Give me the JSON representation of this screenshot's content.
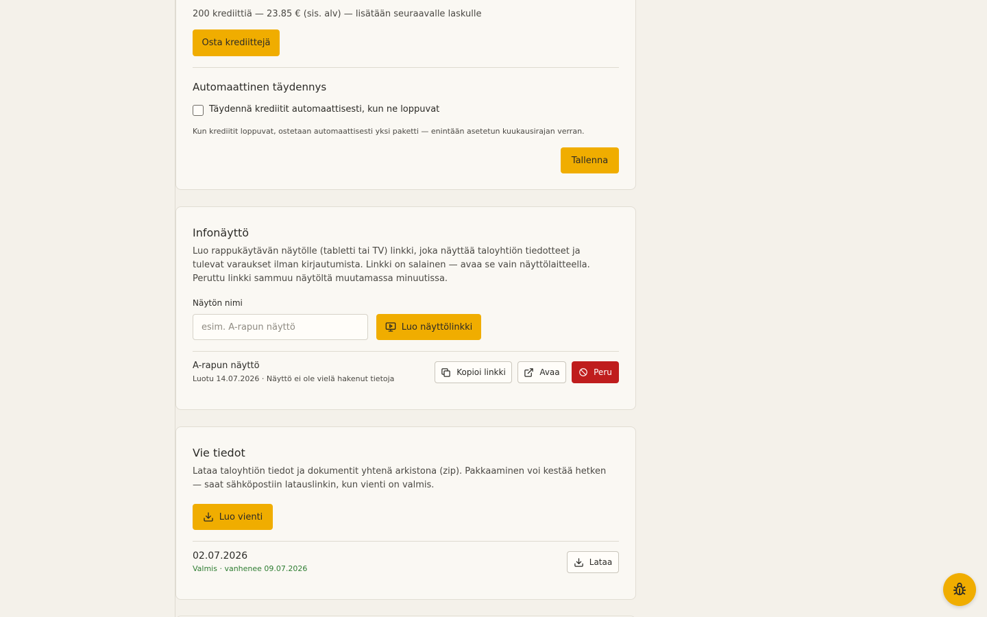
{
  "credits": {
    "package_info": "200 krediittiä — 23.85 € (sis. alv) — lisätään seuraavalle laskulle",
    "buy_label": "Osta krediittejä",
    "auto_title": "Automaattinen täydennys",
    "auto_checkbox_label": "Täydennä krediitit automaattisesti, kun ne loppuvat",
    "auto_checked": false,
    "auto_note": "Kun krediitit loppuvat, ostetaan automaattisesti yksi paketti — enintään asetetun kuukausirajan verran.",
    "save_label": "Tallenna"
  },
  "info_screen": {
    "title": "Infonäyttö",
    "description": "Luo rappukäytävän näytölle (tabletti tai TV) linkki, joka näyttää taloyhtiön tiedotteet ja tulevat varaukset ilman kirjautumista. Linkki on salainen — avaa se vain näyttölaitteella. Peruttu linkki sammuu näytöltä muutamassa minuutissa.",
    "name_label": "Näytön nimi",
    "name_placeholder": "esim. A-rapun näyttö",
    "name_value": "",
    "create_label": "Luo näyttölinkki",
    "screens": [
      {
        "name": "A-rapun näyttö",
        "meta": "Luotu 14.07.2026 · Näyttö ei ole vielä hakenut tietoja",
        "copy_label": "Kopioi linkki",
        "open_label": "Avaa",
        "revoke_label": "Peru"
      }
    ]
  },
  "export": {
    "title": "Vie tiedot",
    "description": "Lataa taloyhtiön tiedot ja dokumentit yhtenä arkistona (zip). Pakkaaminen voi kestää hetken — saat sähköpostiin latauslinkin, kun vienti on valmis.",
    "create_label": "Luo vienti",
    "items": [
      {
        "date": "02.07.2026",
        "status": "Valmis · vanhenee 09.07.2026",
        "download_label": "Lataa"
      }
    ]
  },
  "colors": {
    "accent": "#f0ad00",
    "danger": "#bf1d1d",
    "success": "#2e7d32",
    "background": "#f4f1ea",
    "card": "#faf8f3"
  },
  "icons": {
    "create_screen": "monitor-play-icon",
    "copy": "copy-icon",
    "open": "external-link-icon",
    "revoke": "ban-icon",
    "export": "download-icon",
    "download": "download-icon",
    "fab": "bug-icon"
  }
}
